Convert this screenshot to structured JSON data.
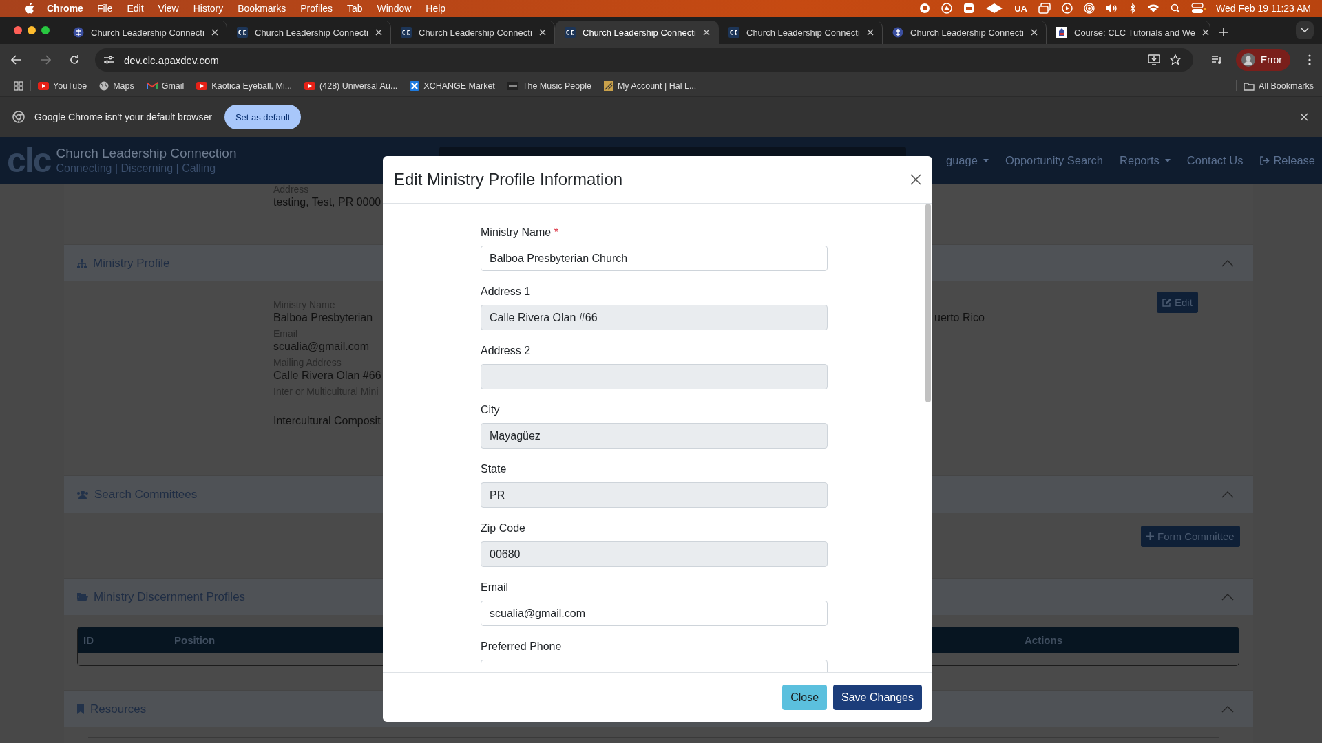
{
  "menu_bar": {
    "app": "Chrome",
    "items": [
      "File",
      "Edit",
      "View",
      "History",
      "Bookmarks",
      "Profiles",
      "Tab",
      "Window",
      "Help"
    ],
    "status_text": "UA",
    "clock": "Wed Feb 19  11:23 AM"
  },
  "tabs": [
    {
      "title": "Church Leadership Connecti",
      "kind": "seal",
      "selected": false
    },
    {
      "title": "Church Leadership Connecti",
      "kind": "clc",
      "selected": false
    },
    {
      "title": "Church Leadership Connecti",
      "kind": "clc",
      "selected": false
    },
    {
      "title": "Church Leadership Connecti",
      "kind": "clc",
      "selected": true
    },
    {
      "title": "Church Leadership Connecti",
      "kind": "clc",
      "selected": false
    },
    {
      "title": "Church Leadership Connecti",
      "kind": "seal",
      "selected": false
    },
    {
      "title": "Course: CLC Tutorials and We",
      "kind": "course",
      "selected": false
    }
  ],
  "address_bar": {
    "url": "dev.clc.apaxdev.com"
  },
  "profile": {
    "label": "Error"
  },
  "bookmarks": [
    {
      "label": "YouTube",
      "kind": "video"
    },
    {
      "label": "Maps",
      "kind": "globe"
    },
    {
      "label": "Gmail",
      "kind": "mail"
    },
    {
      "label": "Kaotica Eyeball, Mi...",
      "kind": "video"
    },
    {
      "label": "(428) Universal Au...",
      "kind": "video"
    },
    {
      "label": "XCHANGE Market",
      "kind": "cross"
    },
    {
      "label": "The Music People",
      "kind": "badge"
    },
    {
      "label": "My Account | Hal L...",
      "kind": "account"
    }
  ],
  "all_bookmarks": "All Bookmarks",
  "infobar": {
    "message": "Google Chrome isn't your default browser",
    "button": "Set as default"
  },
  "site": {
    "logo_text": "clc",
    "title": "Church Leadership Connection",
    "tagline": "Connecting | Discerning | Calling",
    "nav": [
      {
        "label": "guage",
        "dropdown": true
      },
      {
        "label": "Opportunity Search",
        "dropdown": false
      },
      {
        "label": "Reports",
        "dropdown": true
      },
      {
        "label": "Contact Us",
        "dropdown": false
      },
      {
        "label": "Release",
        "dropdown": false
      }
    ]
  },
  "background": {
    "address": {
      "label": "Address",
      "value": "testing, Test, PR 0000"
    },
    "ministry_profile": {
      "title": "Ministry Profile",
      "fields": [
        {
          "label": "Ministry Name",
          "value": "Balboa Presbyterian"
        },
        {
          "label": "Email",
          "value": "scualia@gmail.com"
        },
        {
          "label": "Mailing Address",
          "value": "Calle Rivera Olan #66"
        },
        {
          "label": "Inter or Multicultural Mini",
          "value": "Intercultural Composit"
        }
      ],
      "right_value": "uerto Rico",
      "edit_button": "Edit"
    },
    "search_committees": {
      "title": "Search Committees",
      "button": "Form Committee"
    },
    "discernment_profiles": {
      "title": "Ministry Discernment Profiles",
      "columns": [
        "ID",
        "Position",
        "Actions"
      ]
    },
    "resources": {
      "title": "Resources"
    }
  },
  "modal": {
    "title": "Edit Ministry Profile Information",
    "fields": [
      {
        "label": "Ministry Name",
        "required_mark": "*",
        "value": "Balboa Presbyterian Church",
        "disabled": false
      },
      {
        "label": "Address 1",
        "value": "Calle Rivera Olan #66",
        "disabled": true
      },
      {
        "label": "Address 2",
        "disabled": true
      },
      {
        "label": "City",
        "value": "Mayagüez",
        "disabled": true
      },
      {
        "label": "State",
        "value": "PR",
        "disabled": true
      },
      {
        "label": "Zip Code",
        "value": "00680",
        "disabled": true
      },
      {
        "label": "Email",
        "value": "scualia@gmail.com",
        "disabled": false
      },
      {
        "label": "Preferred Phone",
        "disabled": false
      }
    ],
    "buttons": [
      {
        "label": "Close",
        "kind": "secondary"
      },
      {
        "label": "Save Changes",
        "kind": "primary"
      }
    ]
  }
}
